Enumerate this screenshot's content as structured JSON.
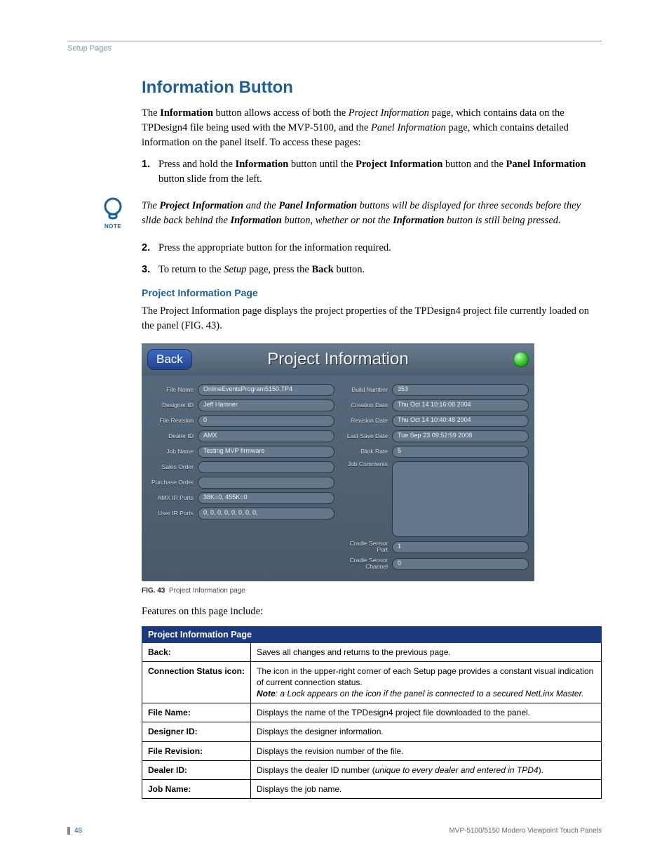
{
  "header": {
    "breadcrumb": "Setup Pages"
  },
  "section": {
    "title": "Information Button",
    "intro_html": "The <b>Information</b> button allows access of both the <i>Project Information</i> page, which contains data on the TPDesign4 file being used with the MVP-5100, and the <i>Panel Information</i> page, which contains detailed information on the panel itself. To access these pages:",
    "step1_html": "Press and hold the <b>Information</b> button until the <b>Project Information</b> button and the <b>Panel Information</b> button slide from the left.",
    "note_html": "The <b>Project Information</b> and the <b>Panel Information</b> buttons will be displayed for three seconds before they slide back behind the <b>Information</b> button, whether or not the <b>Information</b> button is still being pressed.",
    "step2_html": "Press the appropriate button for the information required.",
    "step3_html": "To return to the <i>Setup</i> page, press the <b>Back</b> button.",
    "subhead": "Project Information Page",
    "sub_intro": "The Project Information page displays the project properties of the TPDesign4 project file currently loaded on the panel (FIG. 43).",
    "features_intro": "Features on this page include:"
  },
  "note_icon": {
    "label": "NOTE"
  },
  "panel": {
    "back_label": "Back",
    "title": "Project Information",
    "left": [
      {
        "label": "File Name",
        "value": "OnlineEventsProgram5150.TP4"
      },
      {
        "label": "Designer ID",
        "value": "Jeff Hamner"
      },
      {
        "label": "File Revision",
        "value": "0"
      },
      {
        "label": "Dealer ID",
        "value": "AMX"
      },
      {
        "label": "Job Name",
        "value": "Testing MVP firmware"
      },
      {
        "label": "Sales Order",
        "value": ""
      },
      {
        "label": "Purchase Order",
        "value": ""
      },
      {
        "label": "AMX IR Ports",
        "value": "38K=0, 455K=0"
      },
      {
        "label": "User IR Ports",
        "value": "0, 0, 0, 0, 0, 0, 0, 0,"
      }
    ],
    "right_top": [
      {
        "label": "Build Number",
        "value": "353"
      },
      {
        "label": "Creation Date",
        "value": "Thu Oct 14 10:16:08 2004"
      },
      {
        "label": "Revision Date",
        "value": "Thu Oct 14 10:40:48 2004"
      },
      {
        "label": "Last Save Date",
        "value": "Tue Sep 23 09:52:59 2008"
      },
      {
        "label": "Blink Rate",
        "value": "5"
      }
    ],
    "right_comments": {
      "label": "Job Comments",
      "value": ""
    },
    "right_bottom": [
      {
        "label": "Cradle Sensor Port",
        "value": "1"
      },
      {
        "label": "Cradle Sensor Channel",
        "value": "0"
      }
    ]
  },
  "figure": {
    "num": "FIG. 43",
    "caption": "Project Information page"
  },
  "table": {
    "title": "Project Information Page",
    "rows": [
      {
        "label": "Back:",
        "html": "Saves all changes and returns to the previous page."
      },
      {
        "label": "Connection Status icon:",
        "html": "The icon in the upper-right corner of each Setup page provides a constant visual indication of current connection status.<br><i><b>Note</b>: a Lock appears on the icon if the panel is connected to a secured NetLinx Master.</i>"
      },
      {
        "label": "File Name:",
        "html": "Displays the name of the TPDesign4 project file downloaded to the panel."
      },
      {
        "label": "Designer ID:",
        "html": "Displays the designer information."
      },
      {
        "label": "File Revision:",
        "html": "Displays the revision number of the file."
      },
      {
        "label": "Dealer ID:",
        "html": "Displays the dealer ID number (<i>unique to every dealer and entered in TPD4</i>)."
      },
      {
        "label": "Job Name:",
        "html": "Displays the job name."
      }
    ]
  },
  "footer": {
    "page": "48",
    "text": "MVP-5100/5150 Modero Viewpoint  Touch Panels"
  }
}
